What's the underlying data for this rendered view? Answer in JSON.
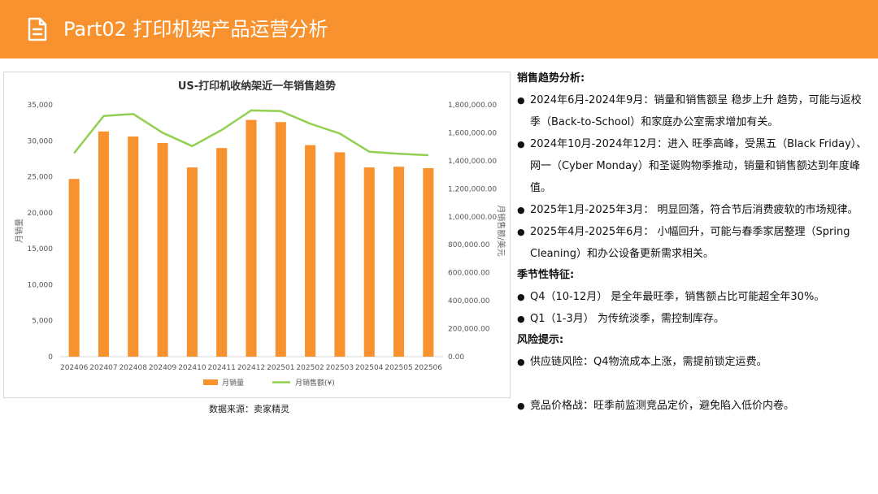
{
  "header": {
    "title": "Part02 打印机架产品运营分析",
    "accent_color": "#F7922E",
    "icon": "document-icon"
  },
  "source_note": "数据来源：卖家精灵",
  "analysis": {
    "trend_heading": "销售趋势分析:",
    "trend_items": [
      "2024年6月-2024年9月：销量和销售额呈 稳步上升 趋势，可能与返校季（Back-to-School）和家庭办公室需求增加有关。",
      "2024年10月-2024年12月：进入 旺季高峰，受黑五（Black Friday）、网一（Cyber Monday）和圣诞购物季推动，销量和销售额达到年度峰值。",
      "2025年1月-2025年3月： 明显回落，符合节后消费疲软的市场规律。",
      "2025年4月-2025年6月： 小幅回升，可能与春季家居整理（Spring Cleaning）和办公设备更新需求相关。"
    ],
    "season_heading": "季节性特征:",
    "season_items": [
      "Q4（10-12月） 是全年最旺季，销售额占比可能超全年30%。",
      "Q1（1-3月） 为传统淡季，需控制库存。"
    ],
    "risk_heading": "风险提示:",
    "risk_items": [
      "供应链风险：Q4物流成本上涨，需提前锁定运费。",
      "竞品价格战：旺季前监测竞品定价，避免陷入低价内卷。"
    ]
  },
  "chart_data": {
    "type": "bar",
    "title": "US-打印机收纳架近一年销售趋势",
    "categories": [
      "202406",
      "202407",
      "202408",
      "202409",
      "202410",
      "202411",
      "202412",
      "202501",
      "202502",
      "202503",
      "202504",
      "202505",
      "202506"
    ],
    "series": [
      {
        "name": "月销量",
        "type": "bar",
        "axis": "left",
        "color": "#F7922E",
        "values": [
          24700,
          31300,
          30600,
          29700,
          26300,
          29000,
          32900,
          32600,
          29400,
          28400,
          26300,
          26400,
          26200
        ]
      },
      {
        "name": "月销售额(¥)",
        "type": "line",
        "axis": "right",
        "color": "#92D050",
        "values": [
          1455000,
          1720000,
          1735000,
          1600000,
          1505000,
          1620000,
          1760000,
          1755000,
          1665000,
          1595000,
          1465000,
          1450000,
          1440000
        ]
      }
    ],
    "ylabel": "月销量",
    "y2label": "月销售额/美元",
    "ylim": [
      0,
      35000
    ],
    "yticks": [
      "35,000",
      "30,000",
      "25,000",
      "20,000",
      "15,000",
      "10,000",
      "5,000",
      "0"
    ],
    "y2lim": [
      0,
      1800000
    ],
    "y2ticks": [
      "1,800,000.00",
      "1,600,000.00",
      "1,400,000.00",
      "1,200,000.00",
      "1,000,000.00",
      "800,000.00",
      "600,000.00",
      "400,000.00",
      "200,000.00",
      "0.00"
    ],
    "legend_position": "bottom",
    "grid": false
  }
}
